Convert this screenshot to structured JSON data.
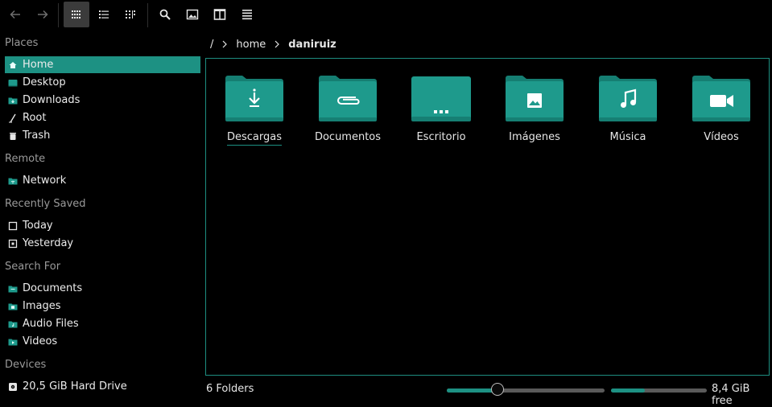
{
  "toolbar": {
    "buttons": [
      "back-icon",
      "forward-icon",
      "grid-view-icon",
      "list-view-icon",
      "column-view-icon",
      "search-icon",
      "preview-icon",
      "split-view-icon",
      "menu-icon"
    ]
  },
  "sidebar": {
    "places_title": "Places",
    "places": [
      {
        "label": "Home",
        "icon": "home-folder-icon",
        "selected": true
      },
      {
        "label": "Desktop",
        "icon": "desktop-icon"
      },
      {
        "label": "Downloads",
        "icon": "downloads-folder-icon"
      },
      {
        "label": "Root",
        "icon": "root-icon"
      },
      {
        "label": "Trash",
        "icon": "trash-icon"
      }
    ],
    "remote_title": "Remote",
    "remote": [
      {
        "label": "Network",
        "icon": "network-icon"
      }
    ],
    "recent_title": "Recently Saved",
    "recent": [
      {
        "label": "Today",
        "icon": "calendar-icon"
      },
      {
        "label": "Yesterday",
        "icon": "calendar-icon"
      }
    ],
    "search_title": "Search For",
    "search": [
      {
        "label": "Documents",
        "icon": "documents-folder-icon"
      },
      {
        "label": "Images",
        "icon": "images-folder-icon"
      },
      {
        "label": "Audio Files",
        "icon": "audio-folder-icon"
      },
      {
        "label": "Videos",
        "icon": "videos-folder-icon"
      }
    ],
    "devices_title": "Devices",
    "devices": [
      {
        "label": "20,5 GiB Hard Drive",
        "icon": "hard-drive-icon"
      }
    ]
  },
  "breadcrumb": {
    "root": "/",
    "home": "home",
    "current": "daniruiz"
  },
  "folders": [
    {
      "label": "Descargas",
      "icon": "download-icon"
    },
    {
      "label": "Documentos",
      "icon": "paperclip-icon"
    },
    {
      "label": "Escritorio",
      "icon": "desktop-folder-icon"
    },
    {
      "label": "Imágenes",
      "icon": "image-icon"
    },
    {
      "label": "Música",
      "icon": "music-note-icon"
    },
    {
      "label": "Vídeos",
      "icon": "video-camera-icon"
    }
  ],
  "status": {
    "folder_count": "6 Folders",
    "free_space": "8,4 GiB free",
    "disk_used_fraction": 0.35
  },
  "colors": {
    "accent": "#1d9183",
    "folder": "#1e9a8c",
    "folder_tab": "#157e72"
  }
}
